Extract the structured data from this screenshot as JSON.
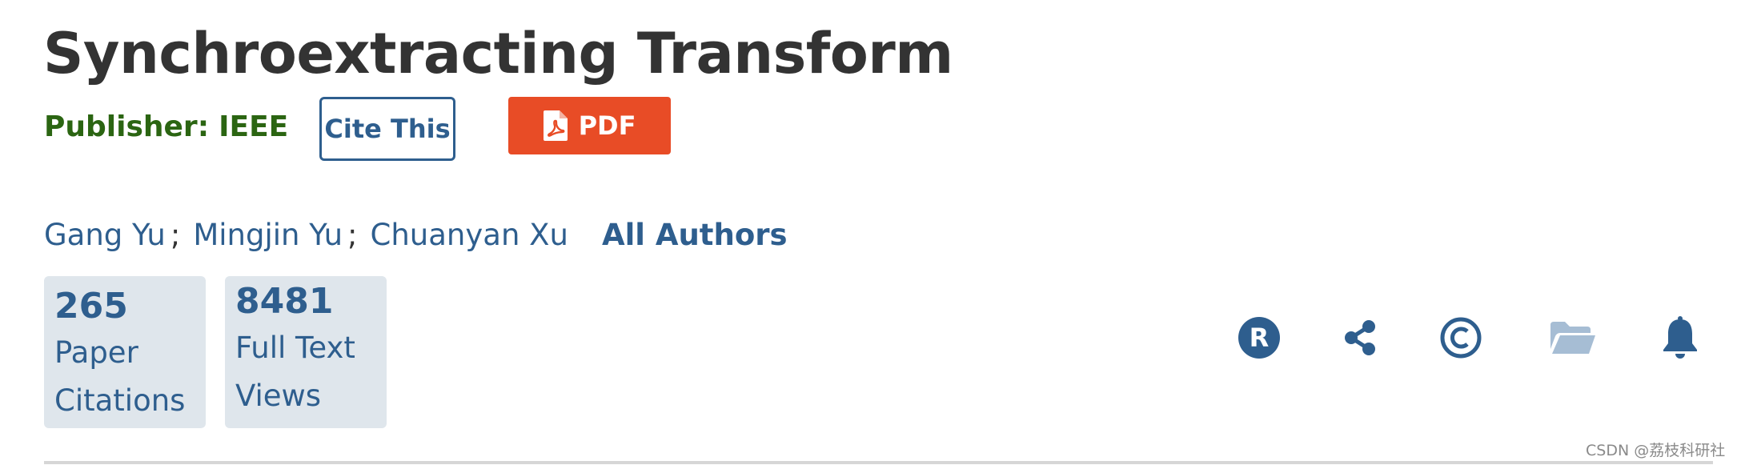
{
  "article": {
    "title": "Synchroextracting Transform",
    "publisher_label": "Publisher:",
    "publisher_name": "IEEE"
  },
  "actions": {
    "cite_label": "Cite This",
    "pdf_label": "PDF"
  },
  "authors": {
    "list": [
      "Gang Yu",
      "Mingjin Yu",
      "Chuanyan Xu"
    ],
    "separator": ";",
    "all_authors_label": "All Authors"
  },
  "metrics": [
    {
      "count": "265",
      "label": "Paper Citations"
    },
    {
      "count": "8481",
      "label": "Full Text Views"
    }
  ],
  "icon_bar": [
    {
      "name": "rights-r-icon",
      "color": "#2e5e8e"
    },
    {
      "name": "share-icon",
      "color": "#2e5e8e"
    },
    {
      "name": "copyright-icon",
      "color": "#2e5e8e"
    },
    {
      "name": "folder-icon",
      "color": "#a6bdd4"
    },
    {
      "name": "bell-icon",
      "color": "#2e5e8e"
    }
  ],
  "colors": {
    "title": "#333333",
    "publisher": "#2b6512",
    "link": "#2e5e8e",
    "pdf_button": "#e84c26",
    "metric_background": "#dfe6ec"
  },
  "watermark": "CSDN @荔枝科研社"
}
